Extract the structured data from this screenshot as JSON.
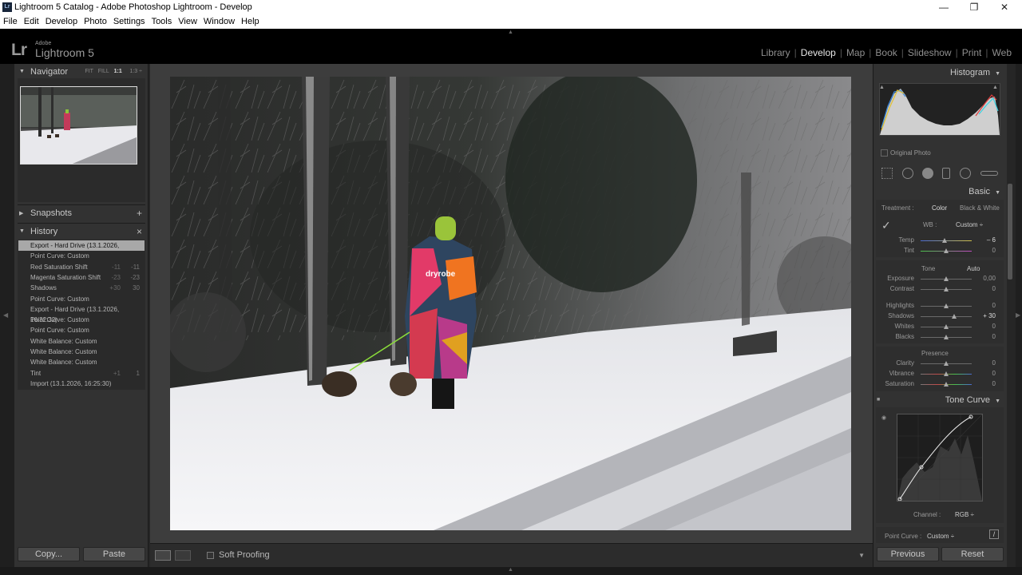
{
  "window": {
    "title": "Lightroom 5 Catalog - Adobe Photoshop Lightroom - Develop",
    "icon_text": "Lr",
    "controls": [
      "minimize-icon",
      "maximize-icon",
      "close-icon"
    ]
  },
  "menu": [
    "File",
    "Edit",
    "Develop",
    "Photo",
    "Settings",
    "Tools",
    "View",
    "Window",
    "Help"
  ],
  "identity": {
    "logo": "Lr",
    "adobe": "Adobe",
    "product": "Lightroom 5"
  },
  "modules": {
    "items": [
      "Library",
      "Develop",
      "Map",
      "Book",
      "Slideshow",
      "Print",
      "Web"
    ],
    "active": "Develop"
  },
  "left": {
    "navigator": {
      "title": "Navigator",
      "fit": "FIT",
      "fill": "FILL",
      "one": "1:1",
      "ratio": "1:3"
    },
    "snapshots": {
      "title": "Snapshots",
      "add": "+"
    },
    "history": {
      "title": "History",
      "close": "×",
      "items": [
        {
          "label": "Export - Hard Drive (13.1.2026, 18:36:30)",
          "a": "",
          "b": ""
        },
        {
          "label": "Point Curve: Custom",
          "a": "",
          "b": ""
        },
        {
          "label": "Red Saturation Shift",
          "a": "-11",
          "b": "-11"
        },
        {
          "label": "Magenta Saturation Shift",
          "a": "-23",
          "b": "-23"
        },
        {
          "label": "Shadows",
          "a": "+30",
          "b": "30"
        },
        {
          "label": "Point Curve: Custom",
          "a": "",
          "b": ""
        },
        {
          "label": "Export - Hard Drive (13.1.2026, 16:32:32)",
          "a": "",
          "b": ""
        },
        {
          "label": "Point Curve: Custom",
          "a": "",
          "b": ""
        },
        {
          "label": "Point Curve: Custom",
          "a": "",
          "b": ""
        },
        {
          "label": "White Balance: Custom",
          "a": "",
          "b": ""
        },
        {
          "label": "White Balance: Custom",
          "a": "",
          "b": ""
        },
        {
          "label": "White Balance: Custom",
          "a": "",
          "b": ""
        },
        {
          "label": "Tint",
          "a": "+1",
          "b": "1"
        },
        {
          "label": "Import (13.1.2026, 16:25:30)",
          "a": "",
          "b": ""
        }
      ]
    },
    "copy": "Copy...",
    "paste": "Paste"
  },
  "toolbar": {
    "soft_proofing": "Soft Proofing"
  },
  "right": {
    "histogram": {
      "title": "Histogram",
      "original_photo": "Original Photo"
    },
    "basic": {
      "title": "Basic",
      "treatment_label": "Treatment :",
      "color": "Color",
      "bw": "Black & White",
      "wb_label": "WB :",
      "wb_value": "Custom ÷",
      "tone_label": "Tone",
      "auto": "Auto",
      "presence_label": "Presence",
      "sliders_wb": [
        {
          "label": "Temp",
          "value": "– 6",
          "pos": 0.47
        },
        {
          "label": "Tint",
          "value": "0",
          "pos": 0.5
        }
      ],
      "sliders_tone": [
        {
          "label": "Exposure",
          "value": "0,00",
          "pos": 0.5
        },
        {
          "label": "Contrast",
          "value": "0",
          "pos": 0.5
        },
        {
          "label": "Highlights",
          "value": "0",
          "pos": 0.5
        },
        {
          "label": "Shadows",
          "value": "+ 30",
          "pos": 0.65
        },
        {
          "label": "Whites",
          "value": "0",
          "pos": 0.5
        },
        {
          "label": "Blacks",
          "value": "0",
          "pos": 0.5
        }
      ],
      "sliders_presence": [
        {
          "label": "Clarity",
          "value": "0",
          "pos": 0.5
        },
        {
          "label": "Vibrance",
          "value": "0",
          "pos": 0.5
        },
        {
          "label": "Saturation",
          "value": "0",
          "pos": 0.5
        }
      ]
    },
    "tone_curve": {
      "title": "Tone Curve",
      "channel_label": "Channel :",
      "channel_value": "RGB ÷",
      "point_curve_label": "Point Curve :",
      "point_curve_value": "Custom ÷"
    },
    "previous": "Previous",
    "reset": "Reset"
  },
  "photo": {
    "coat_text": "dryrobe"
  }
}
